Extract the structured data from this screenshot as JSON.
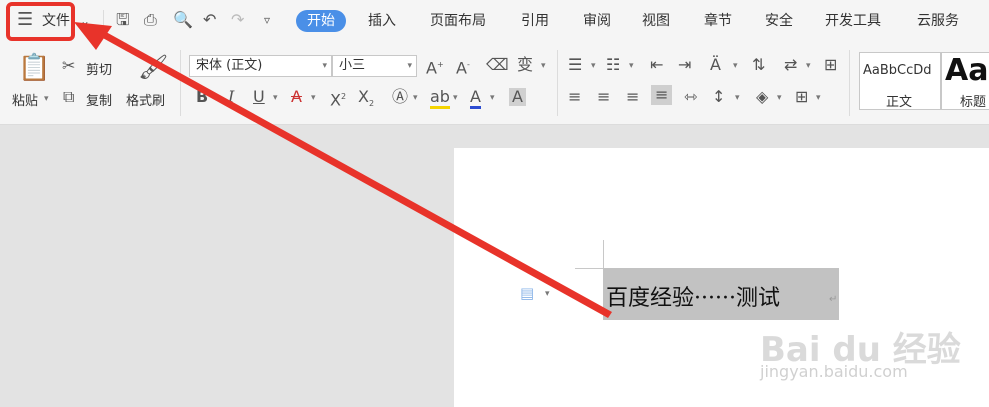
{
  "menu": {
    "file_label": "文件",
    "tabs": [
      "开始",
      "插入",
      "页面布局",
      "引用",
      "审阅",
      "视图",
      "章节",
      "安全",
      "开发工具",
      "云服务"
    ]
  },
  "clipboard": {
    "paste": "粘贴",
    "cut": "剪切",
    "copy": "复制",
    "format_painter": "格式刷"
  },
  "font": {
    "name": "宋体 (正文)",
    "size": "小三"
  },
  "styles": {
    "normal_preview": "AaBbCcDd",
    "normal_label": "正文",
    "heading_preview": "AaI",
    "heading_label": "标题"
  },
  "document": {
    "text": "百度经验······测试"
  },
  "watermark": {
    "logo": "Bai du 经验",
    "url": "jingyan.baidu.com"
  },
  "colors": {
    "active_tab": "#4a8fe7",
    "annotation": "#e8332a",
    "selection": "#c2c2c2"
  }
}
